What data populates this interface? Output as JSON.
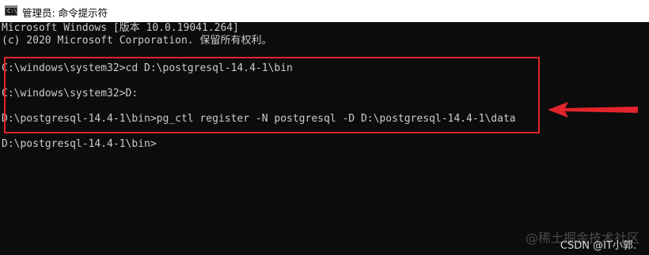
{
  "window": {
    "title": "管理员: 命令提示符",
    "icon_name": "cmd-icon",
    "icon_glyph": "C:\\"
  },
  "console": {
    "lines": [
      "Microsoft Windows [版本 10.0.19041.264]",
      "(c) 2020 Microsoft Corporation. 保留所有权利。",
      "",
      "C:\\windows\\system32>cd D:\\postgresql-14.4-1\\bin",
      "",
      "C:\\windows\\system32>D:",
      "",
      "D:\\postgresql-14.4-1\\bin>pg_ctl register -N postgresql -D D:\\postgresql-14.4-1\\data",
      "",
      "D:\\postgresql-14.4-1\\bin>"
    ]
  },
  "annotation": {
    "box_color": "#e3242b",
    "arrow_color": "#e3242b"
  },
  "watermarks": {
    "primary": "@稀土掘金技术社区",
    "secondary": "CSDN @IT小郭."
  },
  "colors": {
    "console_bg": "#0c0c0c",
    "console_text": "#cccccc",
    "titlebar_bg": "#ffffff"
  }
}
